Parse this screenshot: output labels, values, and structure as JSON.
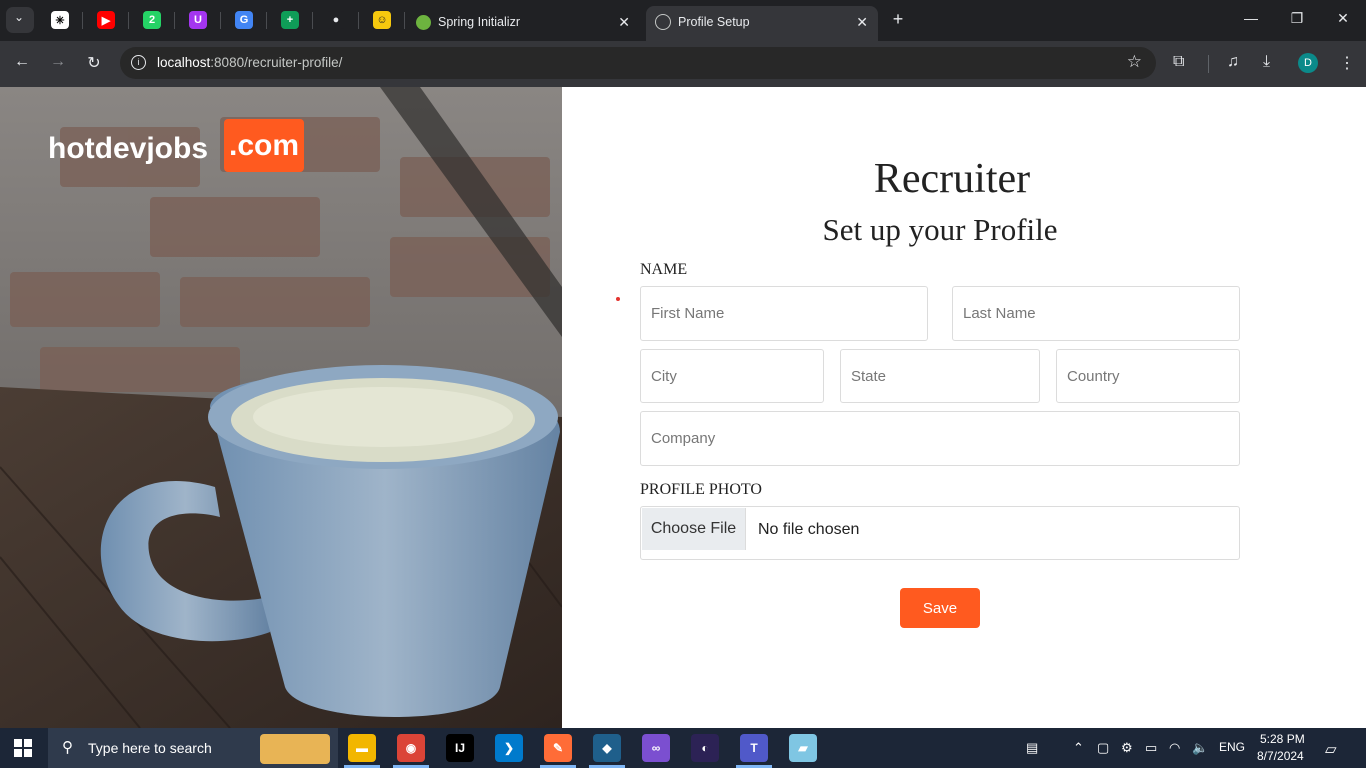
{
  "browser": {
    "pinned_tabs": [
      {
        "name": "chatgpt-icon",
        "glyph": "✳",
        "color": "#ffffff",
        "fg": "#000000"
      },
      {
        "name": "youtube-icon",
        "glyph": "▶",
        "color": "#ff0000",
        "fg": "#ffffff"
      },
      {
        "name": "whatsapp-icon",
        "glyph": "2",
        "color": "#25d366",
        "fg": "#ffffff"
      },
      {
        "name": "udemy-icon",
        "glyph": "U",
        "color": "#a435f0",
        "fg": "#ffffff"
      },
      {
        "name": "google-translate-icon",
        "glyph": "G",
        "color": "#4285f4",
        "fg": "#ffffff"
      },
      {
        "name": "sheets-icon",
        "glyph": "+",
        "color": "#0f9d58",
        "fg": "#ffffff"
      },
      {
        "name": "github-icon",
        "glyph": "●",
        "color": "#202124",
        "fg": "#e8eaed"
      },
      {
        "name": "emoji-icon",
        "glyph": "☺",
        "color": "#f6c90e",
        "fg": "#202124"
      }
    ],
    "tabs": [
      {
        "title": "Spring Initializr",
        "active": false
      },
      {
        "title": "Profile Setup",
        "active": true
      }
    ],
    "url_host": "localhost",
    "url_rest": ":8080/recruiter-profile/",
    "profile_initial": "D"
  },
  "brand": {
    "name": "hotdevjobs",
    "domain": ".com",
    "accent": "#ff5a1f"
  },
  "form": {
    "title": "Recruiter",
    "subtitle": "Set up your Profile",
    "name_label": "NAME",
    "first_name_placeholder": "First Name",
    "last_name_placeholder": "Last Name",
    "city_placeholder": "City",
    "state_placeholder": "State",
    "country_placeholder": "Country",
    "company_placeholder": "Company",
    "photo_label": "PROFILE PHOTO",
    "choose_file_label": "Choose File",
    "no_file_text": "No file chosen",
    "save_label": "Save"
  },
  "taskbar": {
    "search_placeholder": "Type here to search",
    "language": "ENG",
    "time": "5:28 PM",
    "date": "8/7/2024",
    "apps": [
      {
        "name": "file-explorer-icon",
        "glyph": "▬",
        "color": "#f2b600"
      },
      {
        "name": "chrome-icon",
        "glyph": "◉",
        "color": "#db4437"
      },
      {
        "name": "intellij-icon",
        "glyph": "IJ",
        "color": "#000000"
      },
      {
        "name": "vscode-icon",
        "glyph": "❯",
        "color": "#007acc"
      },
      {
        "name": "postman-icon",
        "glyph": "✎",
        "color": "#ff6c37"
      },
      {
        "name": "mysql-workbench-icon",
        "glyph": "◆",
        "color": "#1f5f8b"
      },
      {
        "name": "visual-studio-icon",
        "glyph": "∞",
        "color": "#7b4fd0"
      },
      {
        "name": "eclipse-icon",
        "glyph": "◐",
        "color": "#2c2255"
      },
      {
        "name": "teams-icon",
        "glyph": "T",
        "color": "#5059c9"
      },
      {
        "name": "notes-app-icon",
        "glyph": "▰",
        "color": "#7fc6e3"
      }
    ]
  }
}
